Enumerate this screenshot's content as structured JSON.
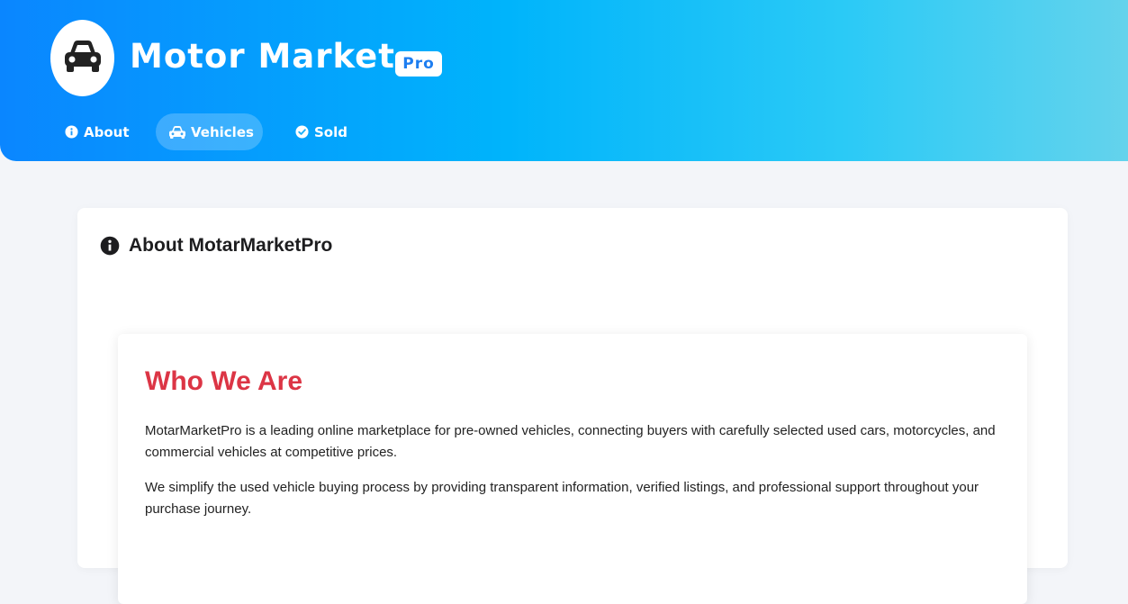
{
  "header": {
    "brand": "Motor Market",
    "badge": "Pro",
    "logo_icon": "car-icon",
    "gradient": [
      "#0a86ff",
      "#00b4fb",
      "#64d3ec"
    ]
  },
  "nav": {
    "items": [
      {
        "label": "About",
        "icon": "info-circle-icon",
        "active": false
      },
      {
        "label": "Vehicles",
        "icon": "car-icon",
        "active": true
      },
      {
        "label": "Sold",
        "icon": "check-circle-icon",
        "active": false
      }
    ]
  },
  "section": {
    "title": "About MotarMarketPro",
    "icon": "info-circle-icon"
  },
  "about": {
    "heading": "Who We Are",
    "heading_color": "#dc3545",
    "paragraphs": [
      "MotarMarketPro is a leading online marketplace for pre-owned vehicles, connecting buyers with carefully selected used cars, motorcycles, and commercial vehicles at competitive prices.",
      "We simplify the used vehicle buying process by providing transparent information, verified listings, and professional support throughout your purchase journey."
    ]
  }
}
